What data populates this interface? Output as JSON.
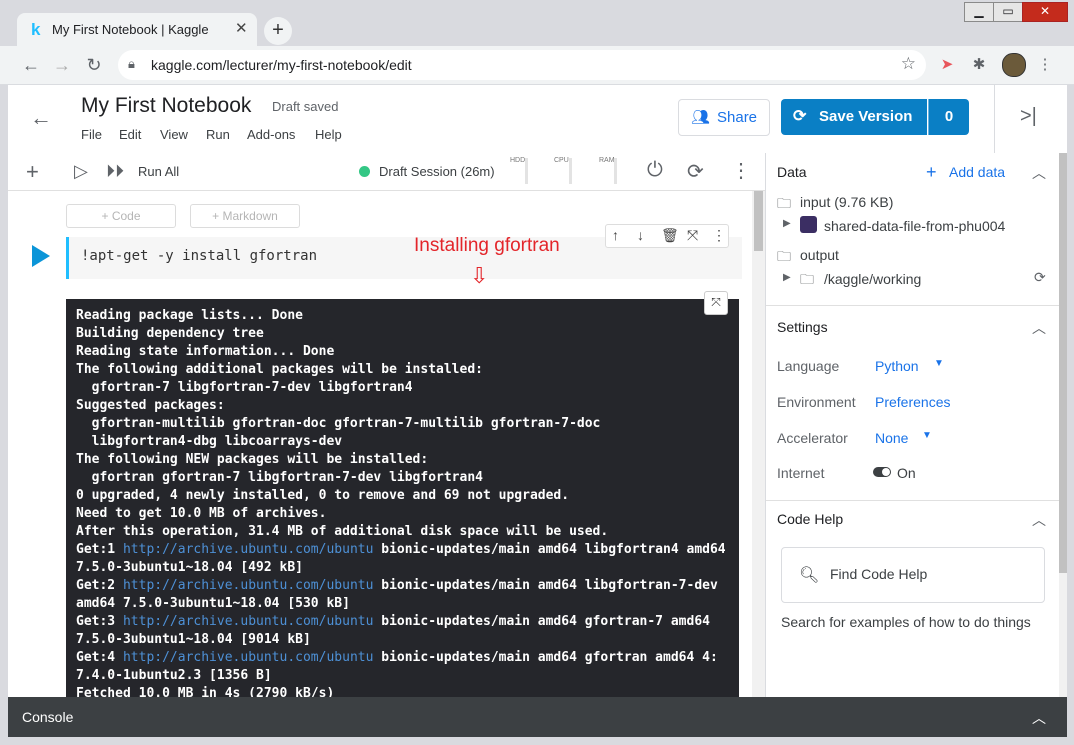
{
  "browser": {
    "tab_title": "My First Notebook | Kaggle",
    "favicon": "k",
    "url": "kaggle.com/lecturer/my-first-notebook/edit",
    "icons": [
      "back-icon",
      "forward-icon",
      "reload-icon",
      "lock-icon",
      "star-icon",
      "extension-icon",
      "puzzle-icon",
      "menu-icon"
    ]
  },
  "header": {
    "title": "My First Notebook",
    "status": "Draft saved",
    "menus": [
      "File",
      "Edit",
      "View",
      "Run",
      "Add-ons",
      "Help"
    ],
    "share_label": "Share",
    "save_label": "Save Version",
    "save_count": "0"
  },
  "toolbar": {
    "run_all": "Run All",
    "session": "Draft Session (26m)",
    "meters": [
      "HDD",
      "CPU",
      "RAM"
    ]
  },
  "notebook": {
    "add_code": "+ Code",
    "add_markdown": "+ Markdown",
    "cell_code": "!apt-get -y install gfortran",
    "annotation": "Installing gfortran",
    "output_lines": [
      {
        "t": "Reading package lists... Done"
      },
      {
        "t": "Building dependency tree"
      },
      {
        "t": "Reading state information... Done"
      },
      {
        "t": "The following additional packages will be installed:"
      },
      {
        "t": "  gfortran-7 libgfortran-7-dev libgfortran4"
      },
      {
        "t": "Suggested packages:"
      },
      {
        "t": "  gfortran-multilib gfortran-doc gfortran-7-multilib gfortran-7-doc"
      },
      {
        "t": "  libgfortran4-dbg libcoarrays-dev"
      },
      {
        "t": "The following NEW packages will be installed:"
      },
      {
        "t": "  gfortran gfortran-7 libgfortran-7-dev libgfortran4"
      },
      {
        "t": "0 upgraded, 4 newly installed, 0 to remove and 69 not upgraded."
      },
      {
        "t": "Need to get 10.0 MB of archives."
      },
      {
        "t": "After this operation, 31.4 MB of additional disk space will be used."
      },
      {
        "pre": "Get:1 ",
        "link": "http://archive.ubuntu.com/ubuntu",
        "post": " bionic-updates/main amd64 libgfortran4 amd64"
      },
      {
        "t": "7.5.0-3ubuntu1~18.04 [492 kB]"
      },
      {
        "pre": "Get:2 ",
        "link": "http://archive.ubuntu.com/ubuntu",
        "post": " bionic-updates/main amd64 libgfortran-7-dev"
      },
      {
        "t": "amd64 7.5.0-3ubuntu1~18.04 [530 kB]"
      },
      {
        "pre": "Get:3 ",
        "link": "http://archive.ubuntu.com/ubuntu",
        "post": " bionic-updates/main amd64 gfortran-7 amd64"
      },
      {
        "t": "7.5.0-3ubuntu1~18.04 [9014 kB]"
      },
      {
        "pre": "Get:4 ",
        "link": "http://archive.ubuntu.com/ubuntu",
        "post": " bionic-updates/main amd64 gfortran amd64 4:"
      },
      {
        "t": "7.4.0-1ubuntu2.3 [1356 B]"
      },
      {
        "t": "Fetched 10.0 MB in 4s (2790 kB/s)"
      }
    ]
  },
  "panel": {
    "data_title": "Data",
    "add_data": "Add data",
    "input_label": "input (9.76 KB)",
    "dataset": "shared-data-file-from-phu004",
    "output_label": "output",
    "working": "/kaggle/working",
    "settings_title": "Settings",
    "language_label": "Language",
    "language_value": "Python",
    "environment_label": "Environment",
    "environment_value": "Preferences",
    "accelerator_label": "Accelerator",
    "accelerator_value": "None",
    "internet_label": "Internet",
    "internet_value": "On",
    "code_help_title": "Code Help",
    "find_placeholder": "Find Code Help",
    "help_text": "Search for examples of how to do things"
  },
  "console": {
    "label": "Console"
  },
  "colors": {
    "accent": "#20beff",
    "save_blue": "#0a7fc5",
    "link_blue": "#1a73e8",
    "annotation_red": "#e3252a",
    "output_bg": "#25262b"
  }
}
